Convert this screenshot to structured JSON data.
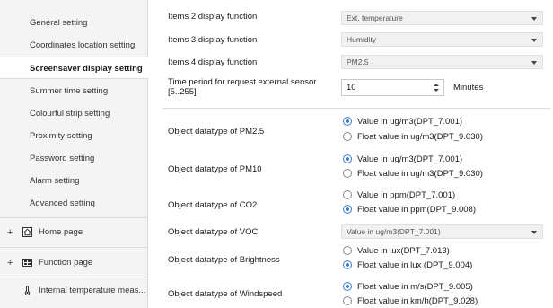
{
  "sidebar": {
    "items": [
      {
        "label": "General setting"
      },
      {
        "label": "Coordinates location setting"
      },
      {
        "label": "Screensaver display setting"
      },
      {
        "label": "Summer time setting"
      },
      {
        "label": "Colourful strip setting"
      },
      {
        "label": "Proximity setting"
      },
      {
        "label": "Password setting"
      },
      {
        "label": "Alarm setting"
      },
      {
        "label": "Advanced setting"
      }
    ],
    "groups": [
      {
        "label": "Home page",
        "icon": "home-icon"
      },
      {
        "label": "Function page",
        "icon": "function-grid-icon"
      },
      {
        "label": "Internal temperature meas...",
        "icon": "thermometer-icon"
      }
    ]
  },
  "main": {
    "items_display": [
      {
        "label": "Items 2 display function",
        "value": "Ext. temperature"
      },
      {
        "label": "Items 3 display function",
        "value": "Humidity"
      },
      {
        "label": "Items 4 display function",
        "value": "PM2.5"
      }
    ],
    "request_period": {
      "label_line1": "Time period for request external sensor",
      "label_line2": "[5..255]",
      "value": "10",
      "unit": "Minutes"
    },
    "datatypes": [
      {
        "label": "Object datatype of PM2.5",
        "options": [
          "Value in ug/m3(DPT_7.001)",
          "Float value in ug/m3(DPT_9.030)"
        ],
        "selected": 0
      },
      {
        "label": "Object datatype of PM10",
        "options": [
          "Value in ug/m3(DPT_7.001)",
          "Float value in ug/m3(DPT_9.030)"
        ],
        "selected": 0
      },
      {
        "label": "Object datatype of CO2",
        "options": [
          "Value in ppm(DPT_7.001)",
          "Float value in ppm(DPT_9.008)"
        ],
        "selected": 1
      },
      {
        "label": "Object datatype of Brightness",
        "options": [
          "Value in lux(DPT_7.013)",
          "Float value in lux (DPT_9.004)"
        ],
        "selected": 1
      },
      {
        "label": "Object datatype of Windspeed",
        "options": [
          "Float value in m/s(DPT_9.005)",
          "Float value in km/h(DPT_9.028)"
        ],
        "selected": 0
      }
    ],
    "voc": {
      "label": "Object datatype of VOC",
      "value": "Value in ug/m3(DPT_7.001)"
    }
  },
  "colors": {
    "accent": "#3b7bd4",
    "sidebar_bg": "#f4f4f4",
    "combo_bg": "#f1f1f1"
  }
}
